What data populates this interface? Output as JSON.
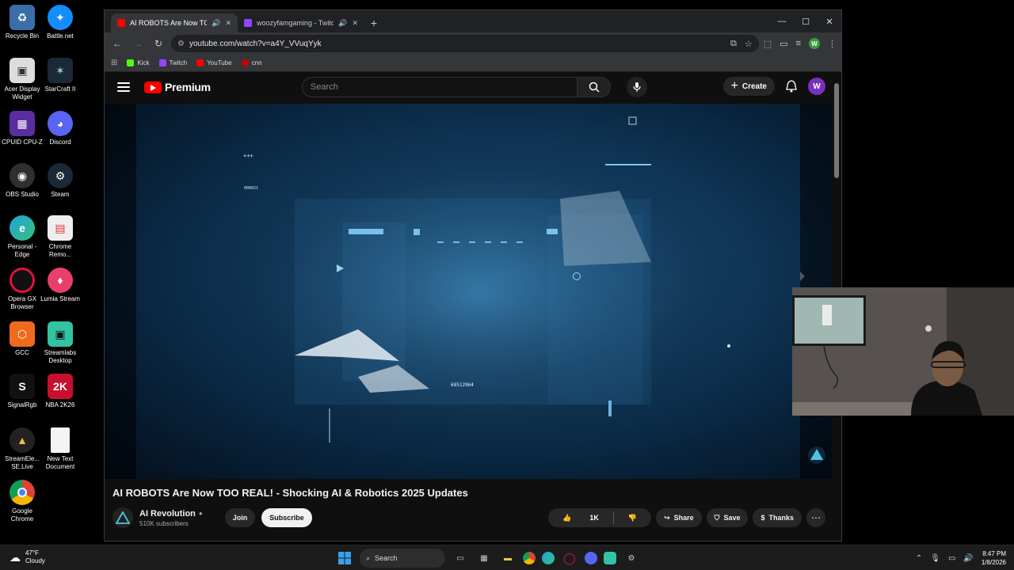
{
  "desktop": {
    "icons": [
      {
        "label": "Recycle Bin"
      },
      {
        "label": "Battle.net"
      },
      {
        "label": "Acer Display Widget"
      },
      {
        "label": "StarCraft II"
      },
      {
        "label": "CPUID CPU-Z"
      },
      {
        "label": "Discord"
      },
      {
        "label": "OBS Studio"
      },
      {
        "label": "Steam"
      },
      {
        "label": "Personal - Edge"
      },
      {
        "label": "Chrome Remo..."
      },
      {
        "label": "Opera GX Browser"
      },
      {
        "label": "Lumia Stream"
      },
      {
        "label": "GCC"
      },
      {
        "label": "Streamlabs Desktop"
      },
      {
        "label": "SignalRgb"
      },
      {
        "label": "NBA 2K26"
      },
      {
        "label": "StreamEle... SE.Live"
      },
      {
        "label": "New Text Document"
      },
      {
        "label": "Google Chrome"
      }
    ]
  },
  "browser": {
    "tabs": [
      {
        "title": "AI ROBOTS Are Now TOO R",
        "active": true
      },
      {
        "title": "woozyfamgaming - Twitch",
        "active": false
      }
    ],
    "url": "youtube.com/watch?v=a4Y_VVuqYyk",
    "profile_initial": "W",
    "bookmarks": [
      {
        "label": "Kick",
        "color": "#53fc18"
      },
      {
        "label": "Twitch",
        "color": "#9146ff"
      },
      {
        "label": "YouTube",
        "color": "#ff0000"
      },
      {
        "label": "cnn",
        "color": "#cc0000"
      }
    ]
  },
  "youtube": {
    "brand": "Premium",
    "search_placeholder": "Search",
    "create_label": "Create",
    "avatar_initial": "W",
    "video_overlay_text": "68512964",
    "video_overlay_small": "000021",
    "video_title": "AI ROBOTS Are Now TOO REAL! - Shocking AI & Robotics 2025 Updates",
    "channel_name": "AI Revolution",
    "channel_subs": "510K subscribers",
    "join_label": "Join",
    "subscribe_label": "Subscribe",
    "like_count": "1K",
    "share_label": "Share",
    "save_label": "Save",
    "thanks_label": "Thanks"
  },
  "taskbar": {
    "weather_temp": "47°F",
    "weather_cond": "Cloudy",
    "search_label": "Search",
    "time": "8:47 PM",
    "date": "1/8/2026"
  },
  "colors": {
    "yt_red": "#ff0000",
    "accent_avatar": "#7b2fbf",
    "chrome_dark": "#202124"
  }
}
